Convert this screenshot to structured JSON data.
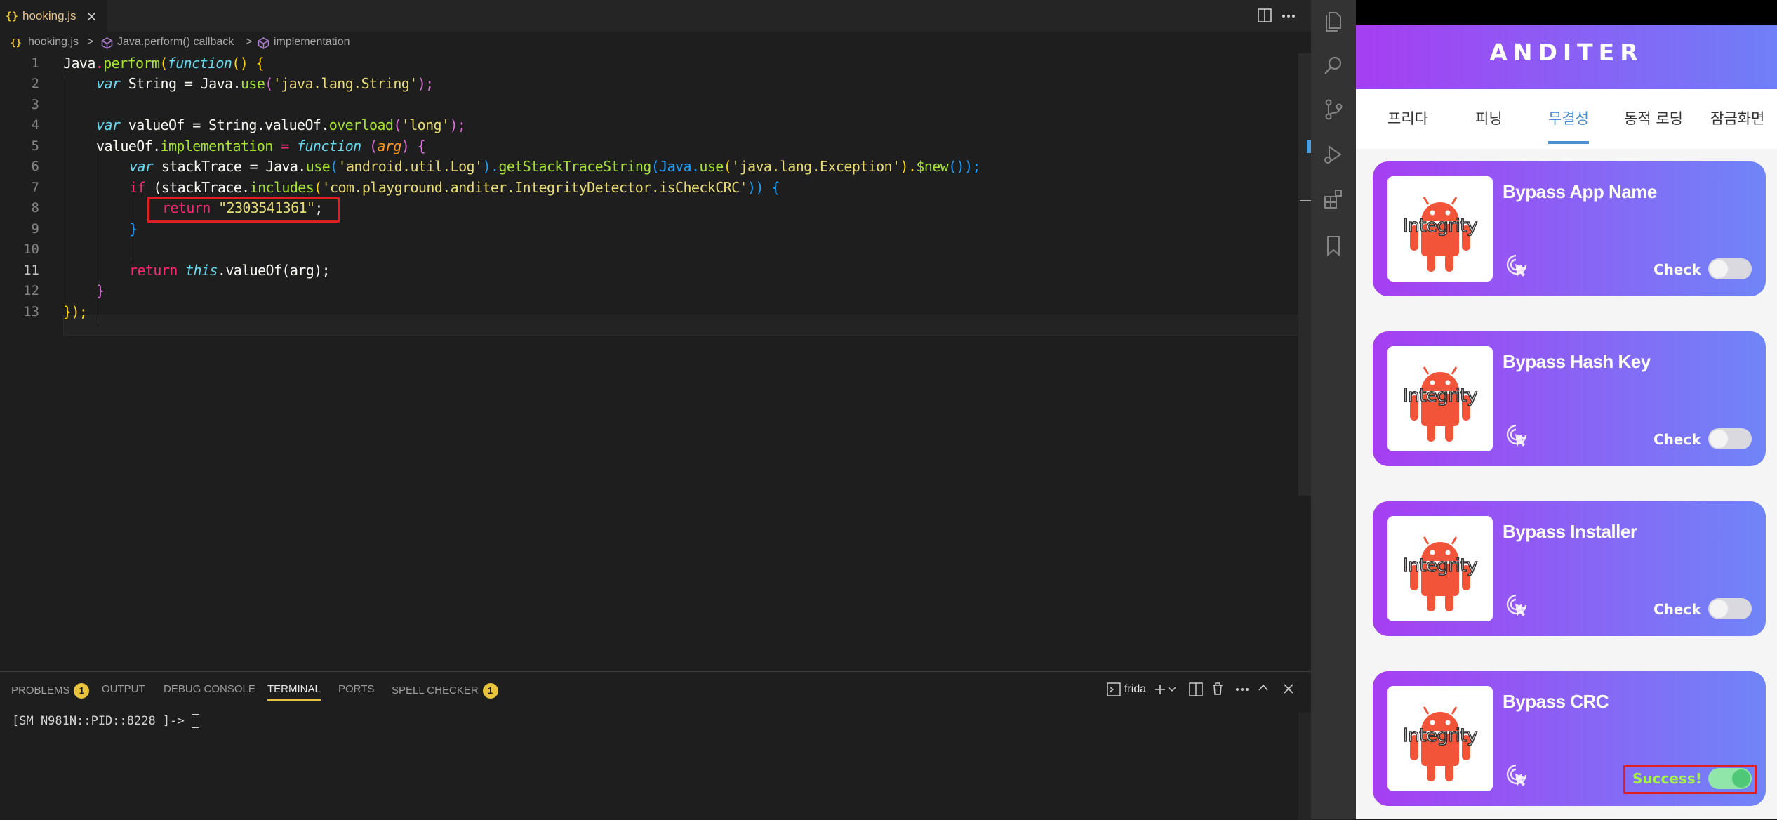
{
  "editor_tab": {
    "icon": "{}",
    "label": "hooking.js",
    "close": "×"
  },
  "breadcrumb": {
    "file": "hooking.js",
    "sep": ">",
    "item1": "Java.perform() callback",
    "item2": "implementation"
  },
  "code_lines": {
    "n1": "1",
    "n2": "2",
    "n3": "3",
    "n4": "4",
    "n5": "5",
    "n6": "6",
    "n7": "7",
    "n8": "8",
    "n9": "9",
    "n10": "10",
    "n11": "11",
    "n12": "12",
    "n13": "13",
    "l1_a": "Java",
    "l1_b": ".",
    "l1_c": "perform",
    "l1_d": "(",
    "l1_e": "function",
    "l1_f": "() {",
    "l2_a": "var",
    "l2_b": " String = Java.",
    "l2_c": "use",
    "l2_d": "(",
    "l2_e": "'java.lang.String'",
    "l2_f": ");",
    "l4_a": "var",
    "l4_b": " valueOf = String.valueOf.",
    "l4_c": "overload",
    "l4_d": "(",
    "l4_e": "'long'",
    "l4_f": ");",
    "l5_a": "valueOf.",
    "l5_b": "implementation",
    "l5_c": " = ",
    "l5_d": "function",
    "l5_e": " (",
    "l5_f": "arg",
    "l5_g": ") {",
    "l6_a": "var",
    "l6_b": " stackTrace = Java.",
    "l6_c": "use",
    "l6_d": "(",
    "l6_e": "'android.util.Log'",
    "l6_f": ").",
    "l6_g": "getStackTraceString",
    "l6_h": "(Java.",
    "l6_i": "use",
    "l6_j": "(",
    "l6_k": "'java.lang.Exception'",
    "l6_l": ").",
    "l6_m": "$new",
    "l6_n": "());",
    "l7_a": "if",
    "l7_b": " (stackTrace.",
    "l7_c": "includes",
    "l7_d": "(",
    "l7_e": "'com.playground.anditer.IntegrityDetector.isCheckCRC'",
    "l7_f": ")) {",
    "l8_a": "return",
    "l8_b": " ",
    "l8_c": "\"2303541361\"",
    "l8_d": ";",
    "l9": "}",
    "l11_a": "return",
    "l11_b": " this",
    "l11_c": ".valueOf(arg);",
    "l12": "}",
    "l13": "});"
  },
  "panel": {
    "tabs": [
      "PROBLEMS",
      "OUTPUT",
      "DEBUG CONSOLE",
      "TERMINAL",
      "PORTS",
      "SPELL CHECKER"
    ],
    "problems_badge": "1",
    "spell_badge": "1",
    "terminal_name": "frida",
    "terminal_line": "[SM N981N::PID::8228 ]-> "
  },
  "app": {
    "title": "ANDITER",
    "nav": [
      "프리다",
      "피닝",
      "무결성",
      "동적 로딩",
      "잠금화면"
    ],
    "thumb_text": "Integrity",
    "check_label": "Check",
    "success_label": "Success!",
    "cards": [
      {
        "title": "Bypass App Name",
        "state": "off"
      },
      {
        "title": "Bypass Hash Key",
        "state": "off"
      },
      {
        "title": "Bypass Installer",
        "state": "off"
      },
      {
        "title": "Bypass CRC",
        "state": "on"
      }
    ]
  },
  "colors": {
    "accent": "#e8c33d",
    "brand_start": "#a63ef2",
    "brand_end": "#6f85f7",
    "highlight_box": "#e02020",
    "nav_selected": "#4a8fd4"
  }
}
